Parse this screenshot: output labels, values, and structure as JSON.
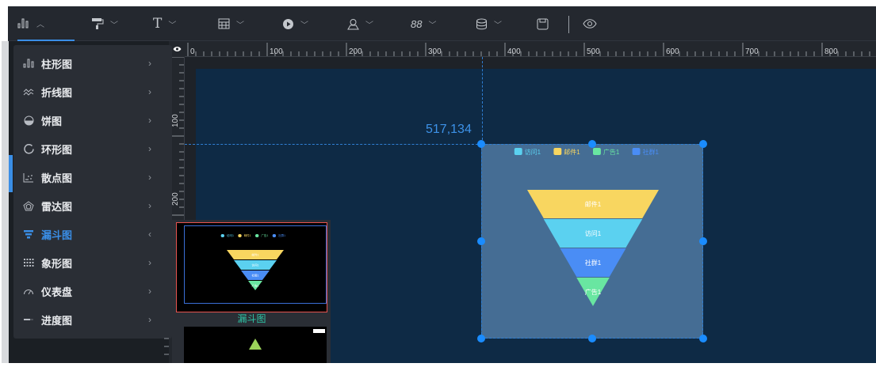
{
  "toolbar": {
    "items": [
      {
        "icon": "bar-chart-icon",
        "active": true
      },
      {
        "icon": "paint-roller-icon"
      },
      {
        "icon": "text-icon",
        "glyph": "T"
      },
      {
        "icon": "table-icon"
      },
      {
        "icon": "media-play-icon"
      },
      {
        "icon": "map-pin-icon"
      },
      {
        "icon": "glyph-88-icon",
        "glyph": "88"
      },
      {
        "icon": "database-icon"
      },
      {
        "icon": "save-icon"
      },
      {
        "icon": "eye-icon"
      }
    ]
  },
  "ruler": {
    "top_labels": [
      "0",
      "100",
      "200",
      "300",
      "400",
      "500",
      "600",
      "700",
      "800"
    ],
    "left_labels": [
      "100",
      "200"
    ]
  },
  "menu": {
    "items": [
      {
        "label": "柱形图",
        "icon": "bar-chart-icon"
      },
      {
        "label": "折线图",
        "icon": "line-chart-icon"
      },
      {
        "label": "饼图",
        "icon": "pie-chart-icon"
      },
      {
        "label": "环形图",
        "icon": "ring-chart-icon"
      },
      {
        "label": "散点图",
        "icon": "scatter-chart-icon"
      },
      {
        "label": "雷达图",
        "icon": "radar-chart-icon"
      },
      {
        "label": "漏斗图",
        "icon": "funnel-chart-icon",
        "active": true
      },
      {
        "label": "象形图",
        "icon": "pictogram-chart-icon"
      },
      {
        "label": "仪表盘",
        "icon": "gauge-icon"
      },
      {
        "label": "进度图",
        "icon": "progress-chart-icon"
      }
    ],
    "arrow_closed": "›",
    "arrow_open": "‹"
  },
  "submenu": {
    "thumb_label": "漏斗图"
  },
  "canvas": {
    "coord_readout": "517,134"
  },
  "chart_data": {
    "type": "funnel",
    "legend": [
      "访问1",
      "邮件1",
      "广告1",
      "社群1"
    ],
    "legend_colors": [
      "#5bd1f0",
      "#f8d660",
      "#69e6a1",
      "#4a8df5"
    ],
    "stages": [
      {
        "name": "邮件1",
        "color": "#f8d660"
      },
      {
        "name": "访问1",
        "color": "#5bd1f0"
      },
      {
        "name": "社群1",
        "color": "#4a8df5"
      },
      {
        "name": "广告1",
        "color": "#69e6a1"
      }
    ],
    "values": [
      100,
      75,
      50,
      25
    ]
  },
  "colors": {
    "accent": "#3a8ee6",
    "canvas": "#0e2a45",
    "selection": "#1a8cff"
  }
}
